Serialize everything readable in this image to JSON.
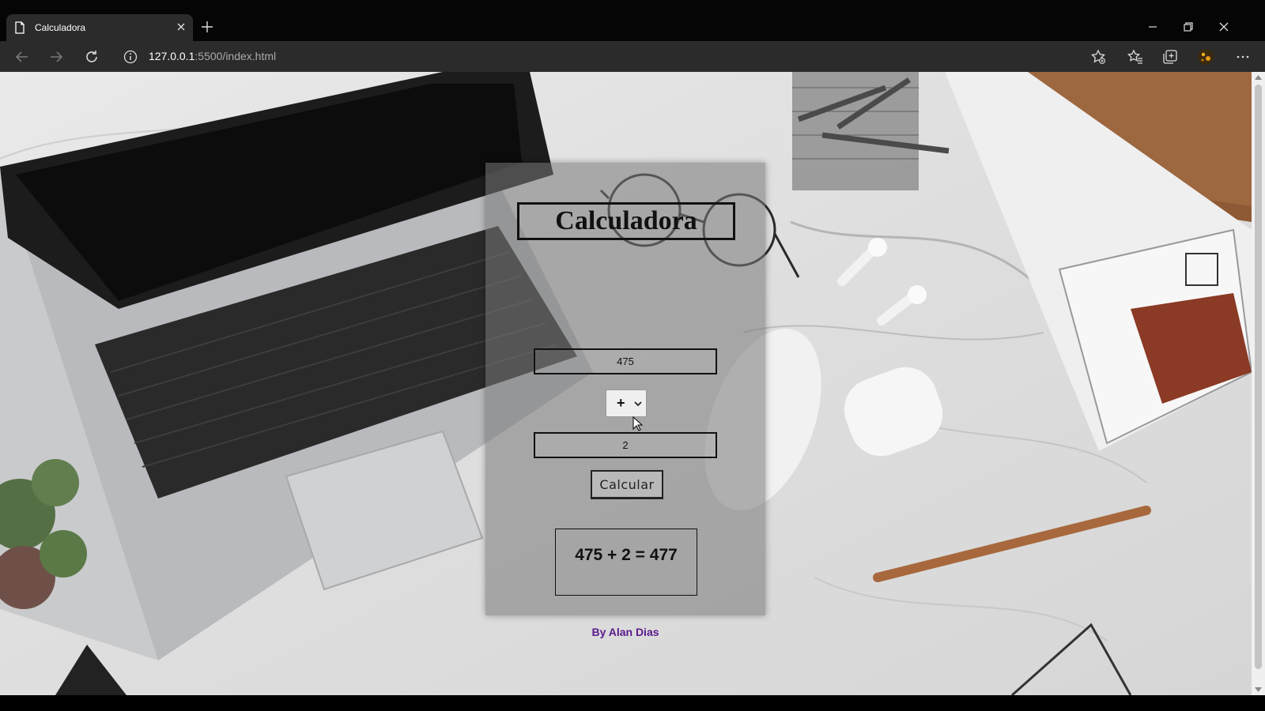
{
  "browser": {
    "tab_title": "Calculadora",
    "url_host": "127.0.0.1",
    "url_rest": ":5500/index.html"
  },
  "calculator": {
    "title": "Calculadora",
    "first_number": "475",
    "operator": "+",
    "second_number": "2",
    "button_label": "Calcular",
    "result": "475 + 2 = 477",
    "author": "By Alan Dias"
  },
  "colors": {
    "author_text": "#5a1a8c",
    "panel_overlay": "rgba(120,120,120,0.55)"
  }
}
